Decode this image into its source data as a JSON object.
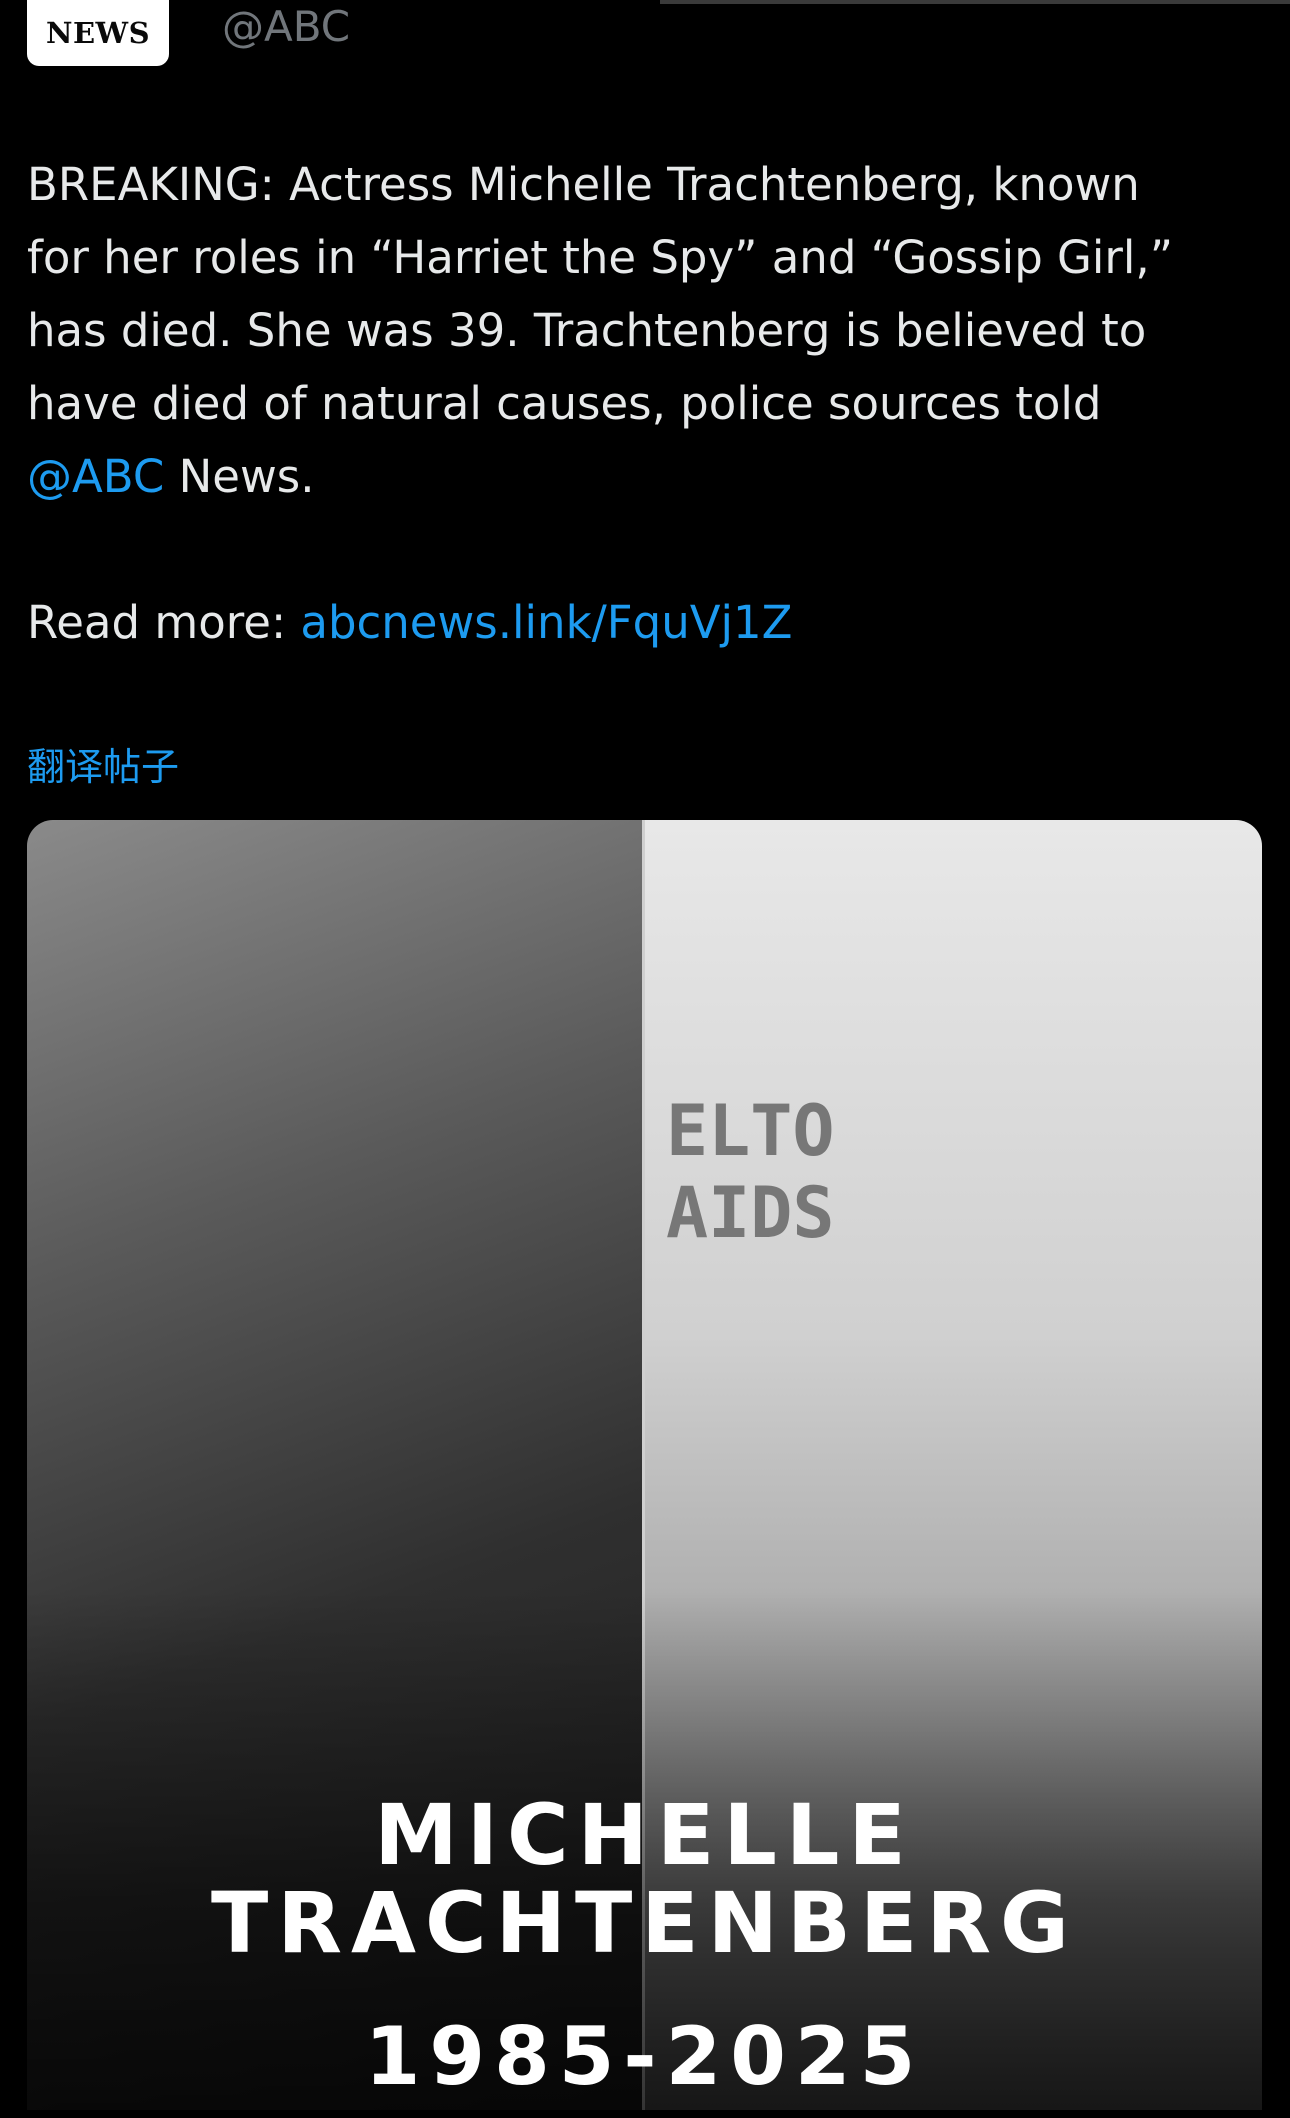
{
  "header": {
    "badge_text": "NEWS",
    "handle": "@ABC"
  },
  "tweet": {
    "line1": "BREAKING: Actress Michelle Trachtenberg, known",
    "line2": "for her roles in “Harriet the Spy” and “Gossip Girl,”",
    "line3": "has died. She was 39. Trachtenberg is believed to",
    "line4": "have died of natural causes, police sources told",
    "mention": "@ABC",
    "line5_rest": " News.",
    "read_more_label": "Read more: ",
    "read_more_link": "abcnews.link/FquVj1Z"
  },
  "translate_label": "翻译帖子",
  "media": {
    "wall_text_line1": "ELTO",
    "wall_text_line2": "AIDS",
    "name_line1": "MICHELLE",
    "name_line2": "TRACHTENBERG",
    "years": "1985-2025"
  },
  "colors": {
    "background": "#000000",
    "text": "#e7e9ea",
    "link": "#1d9bf0",
    "muted": "#71767b"
  }
}
